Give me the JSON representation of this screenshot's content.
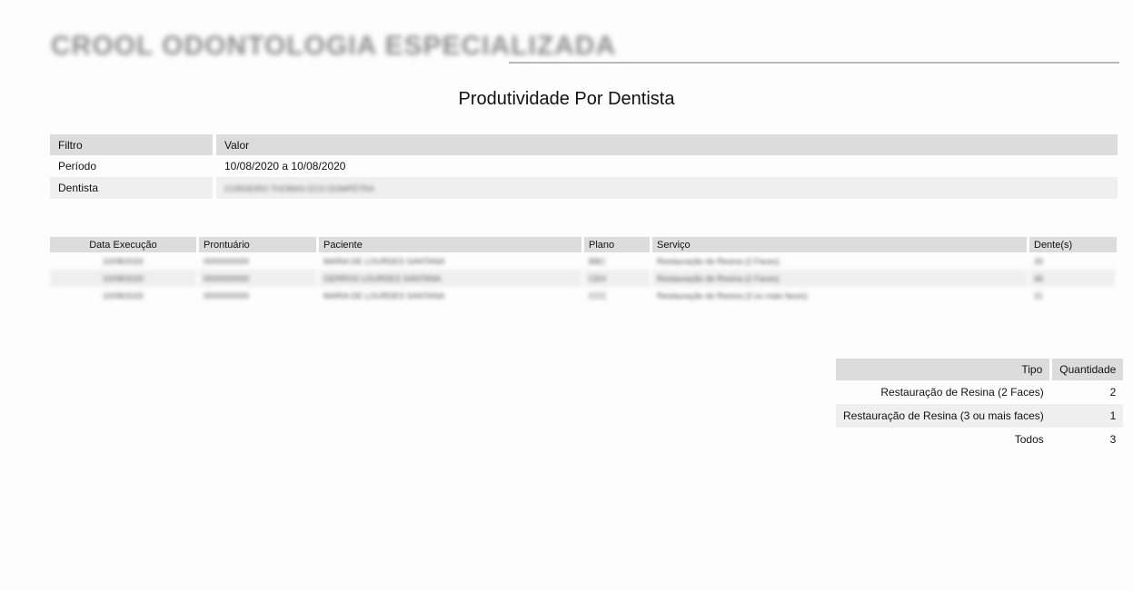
{
  "header": {
    "clinic_name": "CROOL ODONTOLOGIA ESPECIALIZADA",
    "report_title": "Produtividade Por Dentista"
  },
  "filters": {
    "columns": [
      "Filtro",
      "Valor"
    ],
    "rows": [
      {
        "label": "Período",
        "value": "10/08/2020 a 10/08/2020"
      },
      {
        "label": "Dentista",
        "value": "CORDEIRO THOMAS ECO DOMPÉTRA"
      }
    ]
  },
  "table": {
    "columns": [
      "Data Execução",
      "Prontuário",
      "Paciente",
      "Plano",
      "Serviço",
      "Dente(s)"
    ],
    "rows": [
      [
        "10/08/2020",
        "0000000000",
        "MARIA DE LOURDES SANTANA",
        "BBC",
        "Restauração de Resina (2 Faces)",
        "26"
      ],
      [
        "10/08/2020",
        "0000000000",
        "GERROS LOURDES SANTANA",
        "CEH",
        "Restauração de Resina (2 Faces)",
        "46"
      ],
      [
        "10/08/2020",
        "0000000000",
        "MARIA DE LOURDES SANTANA",
        "CCC",
        "Restauração de Resina (3 ou mais faces)",
        "21"
      ]
    ]
  },
  "summary": {
    "columns": [
      "Tipo",
      "Quantidade"
    ],
    "rows": [
      {
        "tipo": "Restauração de Resina (2 Faces)",
        "quantidade": "2"
      },
      {
        "tipo": "Restauração de Resina (3 ou mais faces)",
        "quantidade": "1"
      },
      {
        "tipo": "Todos",
        "quantidade": "3"
      }
    ]
  }
}
